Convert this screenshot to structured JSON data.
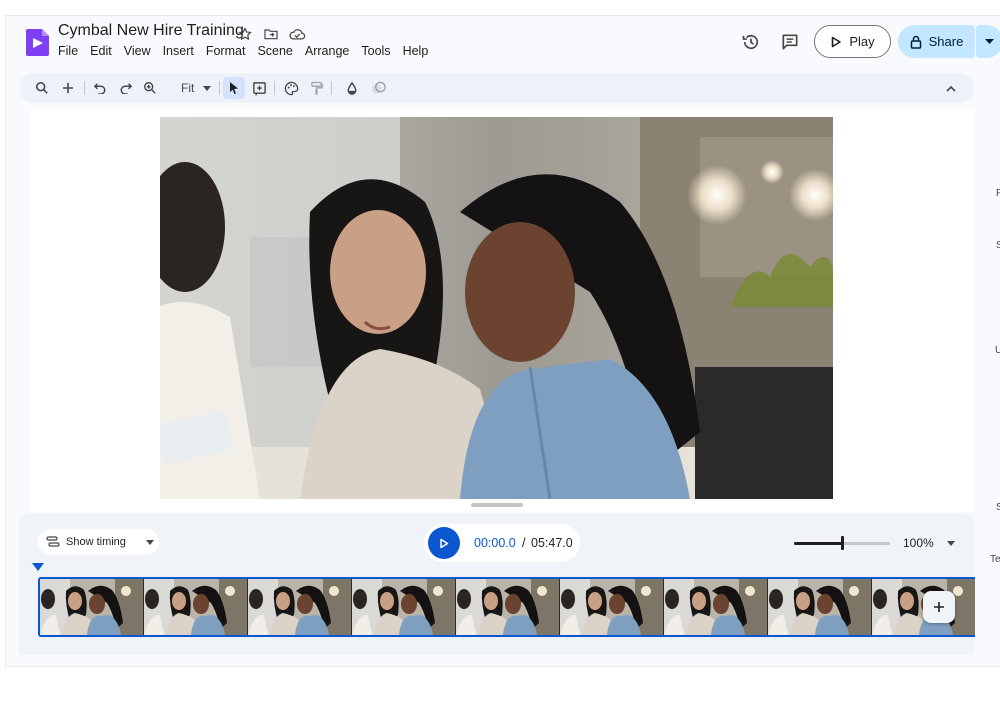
{
  "app": {
    "title": "Cymbal New Hire Training",
    "accent": "#0b57d0",
    "brand": "#7e3ff2"
  },
  "menu": [
    "File",
    "Edit",
    "View",
    "Insert",
    "Format",
    "Scene",
    "Arrange",
    "Tools",
    "Help"
  ],
  "header": {
    "play_label": "Play",
    "share_label": "Share",
    "icons": [
      "star-icon",
      "move-to-folder-icon",
      "cloud-saved-icon",
      "history-icon",
      "comments-icon"
    ]
  },
  "toolbar": {
    "zoom_label": "Fit",
    "icons": [
      "search-icon",
      "add-icon",
      "undo-icon",
      "redo-icon",
      "zoom-icon",
      "select-cursor-icon",
      "add-text-icon",
      "palette-icon",
      "paint-format-icon",
      "fill-color-icon",
      "border-color-icon",
      "collapse-icon"
    ]
  },
  "timeline": {
    "show_timing_label": "Show timing",
    "current_time": "00:00.0",
    "separator": "/",
    "total_time": "05:47.0",
    "zoom_level": "100%",
    "zoom_fraction": 0.5,
    "scene_count_visible": 9
  },
  "right_edge_letters": [
    "F",
    "S",
    "U",
    "S",
    "Te"
  ]
}
